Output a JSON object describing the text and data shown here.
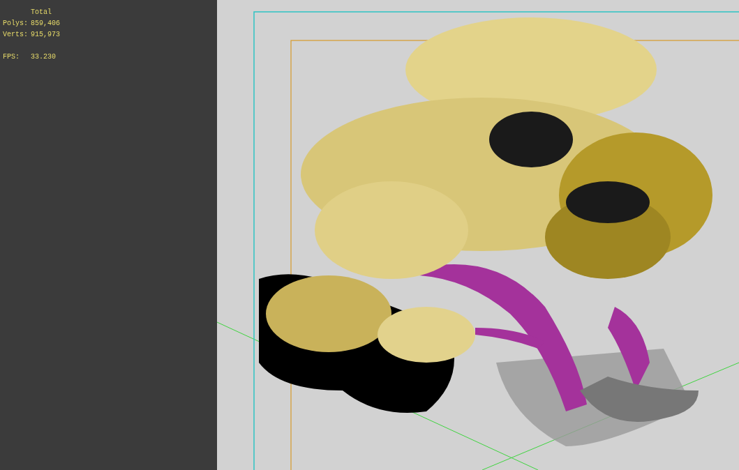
{
  "stats": {
    "header": "Total",
    "rows": [
      {
        "label": "Polys:",
        "value": "859,406"
      },
      {
        "label": "Verts:",
        "value": "915,973"
      }
    ],
    "fps": {
      "label": "FPS:",
      "value": "33.230"
    }
  }
}
